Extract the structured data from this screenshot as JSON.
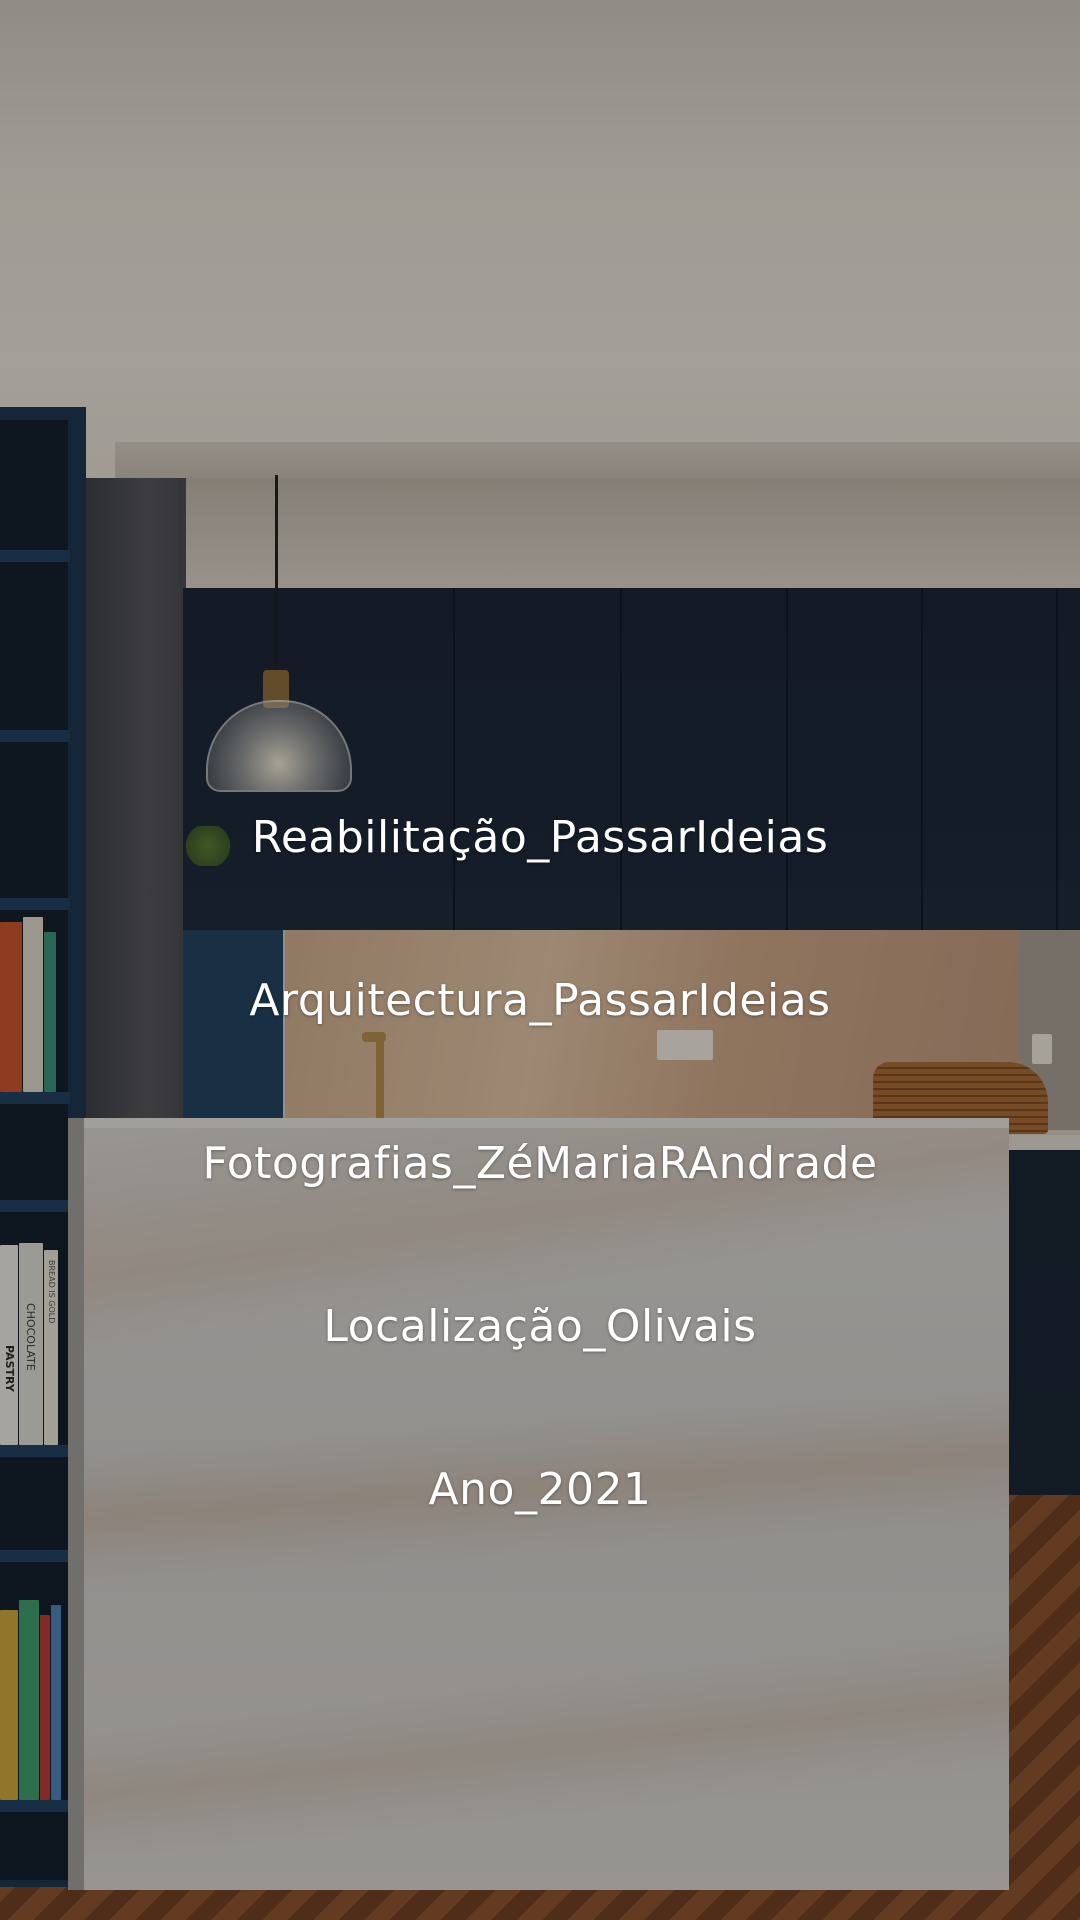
{
  "captions": {
    "line1": "Reabilitação_PassarIdeias",
    "line2": "Arquitectura_PassarIdeias",
    "line3": "Fotografias_ZéMariaRAndrade",
    "line4": "Localização_Olivais",
    "line5": "Ano_2021"
  },
  "book_spines": {
    "pastry": "PASTRY",
    "chocolate": "CHOCOLATE",
    "bread": "BREAD IS GOLD"
  },
  "colors": {
    "cabinet_blue": "#1e2a3a",
    "shelf_blue": "#1f3550",
    "caption_text": "#ffffff"
  }
}
